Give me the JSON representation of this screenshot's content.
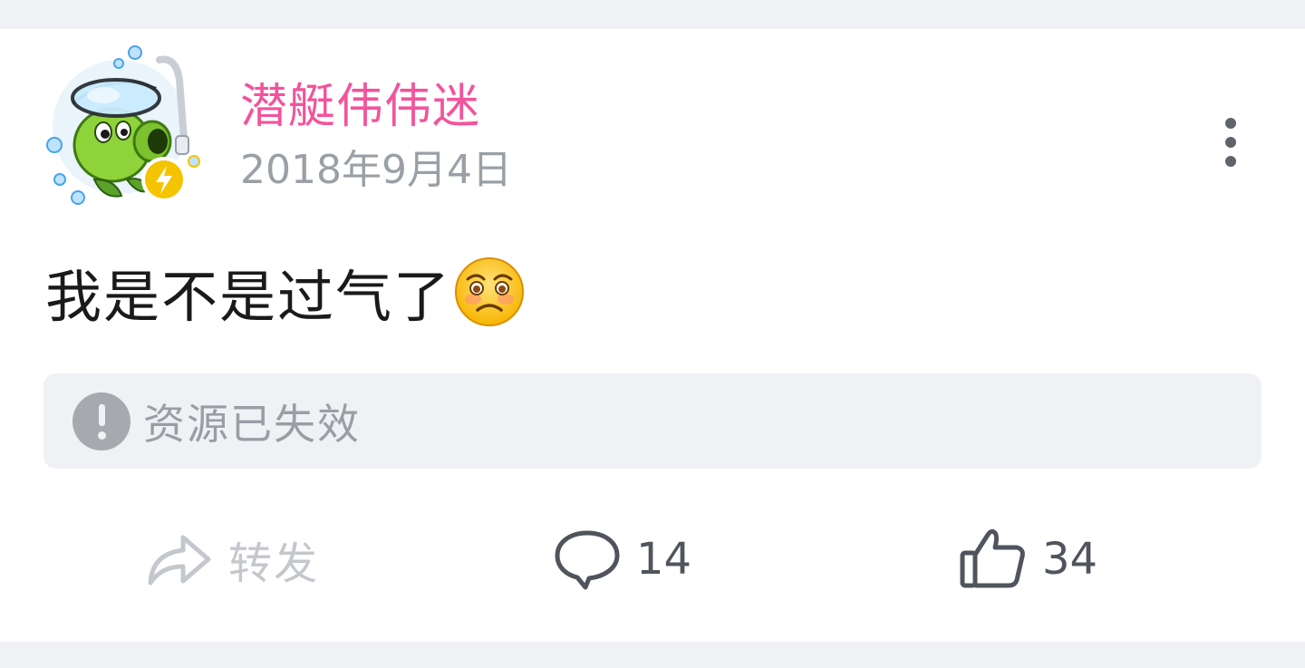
{
  "post": {
    "username": "潜艇伟伟迷",
    "date": "2018年9月4日",
    "content": "我是不是过气了",
    "content_emoji": "worried-face-emoji",
    "avatar": {
      "icon": "peashooter-diver-avatar",
      "badge_icon": "lightning-badge-icon",
      "badge_color": "#f5c400"
    },
    "username_color": "#f2549b"
  },
  "resource_notice": {
    "icon": "exclamation-circle-icon",
    "text": "资源已失效"
  },
  "actions": {
    "forward": {
      "icon": "share-arrow-icon",
      "label": "转发",
      "disabled": true
    },
    "comment": {
      "icon": "comment-bubble-icon",
      "count": "14"
    },
    "like": {
      "icon": "thumbs-up-icon",
      "count": "34"
    }
  },
  "more_menu_icon": "more-vertical-icon"
}
